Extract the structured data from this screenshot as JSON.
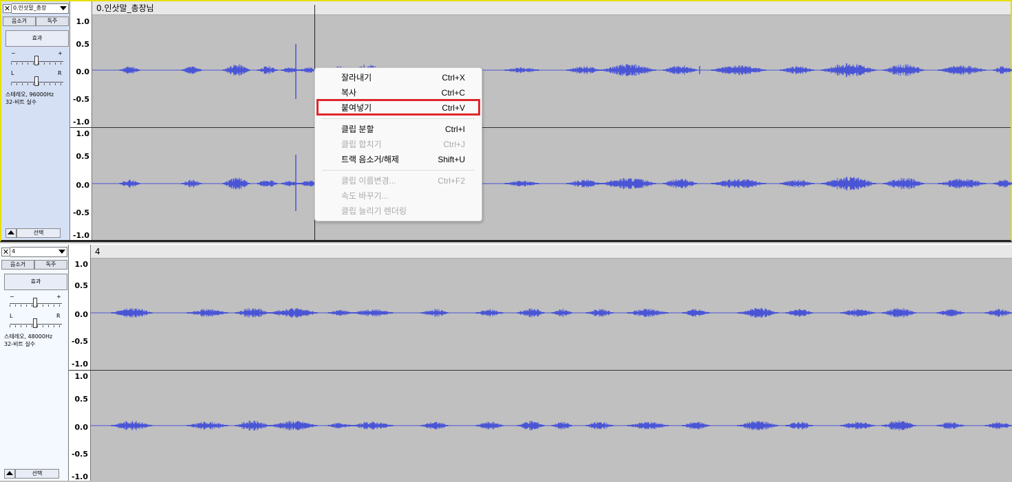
{
  "tracks": [
    {
      "name": "0.인삿말_총장",
      "clip_title": "0.인삿말_총장님",
      "mute_label": "음소거",
      "solo_label": "독주",
      "effects_label": "효과",
      "gain_minus": "−",
      "gain_plus": "+",
      "pan_left": "L",
      "pan_right": "R",
      "info_line1": "스테레오, 96000Hz",
      "info_line2": "32-비트 실수",
      "select_label": "선택",
      "close_label": "✕"
    },
    {
      "name": "4",
      "clip_title": "4",
      "mute_label": "음소거",
      "solo_label": "독주",
      "effects_label": "효과",
      "gain_minus": "−",
      "gain_plus": "+",
      "pan_left": "L",
      "pan_right": "R",
      "info_line1": "스테레오, 48000Hz",
      "info_line2": "32-비트 실수",
      "select_label": "선택",
      "close_label": "✕"
    }
  ],
  "ruler_ticks": [
    "1.0",
    "0.5",
    "0.0",
    "-0.5",
    "-1.0"
  ],
  "context_menu": {
    "items": [
      {
        "label": "잘라내기",
        "shortcut": "Ctrl+X",
        "enabled": true
      },
      {
        "label": "복사",
        "shortcut": "Ctrl+C",
        "enabled": true
      },
      {
        "label": "붙여넣기",
        "shortcut": "Ctrl+V",
        "enabled": true,
        "highlighted": true
      },
      {
        "label": "클립 분할",
        "shortcut": "Ctrl+I",
        "enabled": true
      },
      {
        "label": "클립 합치기",
        "shortcut": "Ctrl+J",
        "enabled": false
      },
      {
        "label": "트랙 음소거/해제",
        "shortcut": "Shift+U",
        "enabled": true
      },
      {
        "label": "클립 이름변경...",
        "shortcut": "Ctrl+F2",
        "enabled": false
      },
      {
        "label": "속도 바꾸기...",
        "shortcut": "",
        "enabled": false
      },
      {
        "label": "클립 늘리기 렌더링",
        "shortcut": "",
        "enabled": false
      }
    ]
  },
  "colors": {
    "waveform": "#4a55d6",
    "selected_track_border": "#e5e000",
    "highlight_box": "#e0262b"
  }
}
